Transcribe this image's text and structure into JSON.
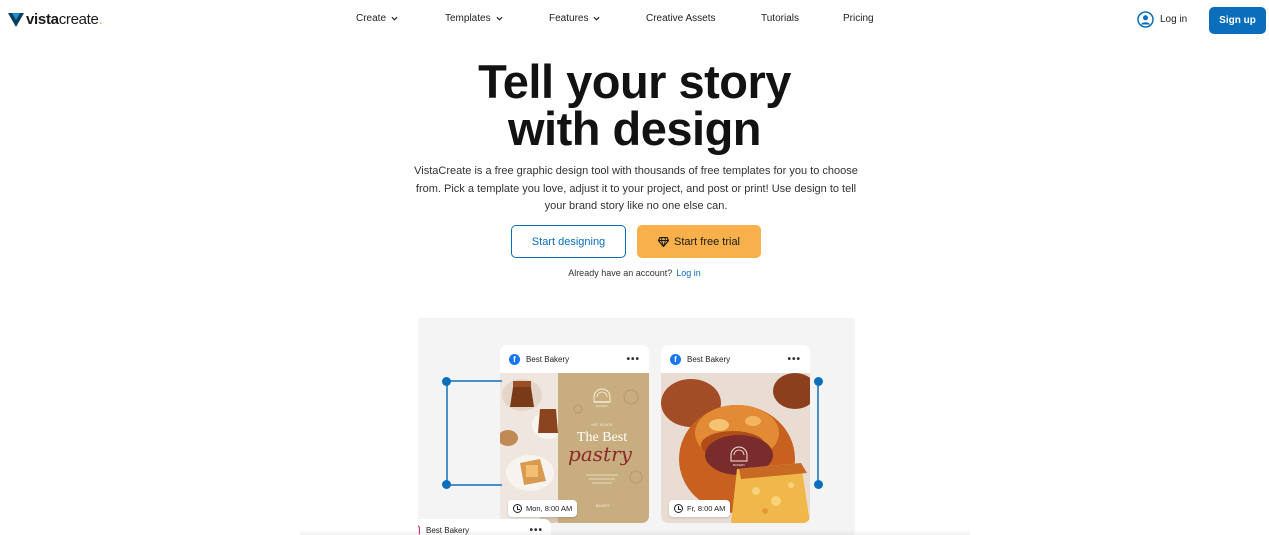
{
  "brand": {
    "name_bold": "vista",
    "name_regular": "create",
    "dot": "."
  },
  "nav": {
    "items": [
      {
        "label": "Create",
        "has_dropdown": true
      },
      {
        "label": "Templates",
        "has_dropdown": true
      },
      {
        "label": "Features",
        "has_dropdown": true
      },
      {
        "label": "Creative Assets",
        "has_dropdown": false
      },
      {
        "label": "Tutorials",
        "has_dropdown": false
      },
      {
        "label": "Pricing",
        "has_dropdown": false
      }
    ],
    "login_label": "Log in",
    "signup_label": "Sign up"
  },
  "hero": {
    "title_line1": "Tell your story",
    "title_line2": "with design",
    "description": "VistaCreate is a free graphic design tool with thousands of free templates for you to choose from. Pick a template you love, adjust it to your project, and post or print! Use design to tell your brand story like no one else can.",
    "start_designing": "Start designing",
    "start_trial": "Start free trial",
    "account_prompt": "Already have an account?",
    "account_login": "Log in"
  },
  "showcase": {
    "card1": {
      "account": "Best Bakery",
      "menu": "•••",
      "time": "Mon, 8:00 AM",
      "poster_kicker": "WE BAKE",
      "poster_title": "The Best",
      "poster_script": "pastry",
      "poster_brand": "BAKERY"
    },
    "card2": {
      "account": "Best Bakery",
      "menu": "•••",
      "time": "Fr, 8:00 AM",
      "badge_text": "BAKERY"
    },
    "card3": {
      "account": "Best Bakery",
      "menu": "•••"
    }
  },
  "colors": {
    "primary": "#0a6ebd",
    "accent": "#f7b04a",
    "poster_bg": "#c8ad7f",
    "poster_script": "#8b2a2a"
  },
  "icons": [
    "vistacreate-logo-icon",
    "chevron-down-icon",
    "user-circle-icon",
    "diamond-icon",
    "facebook-icon",
    "instagram-icon",
    "clock-icon"
  ]
}
